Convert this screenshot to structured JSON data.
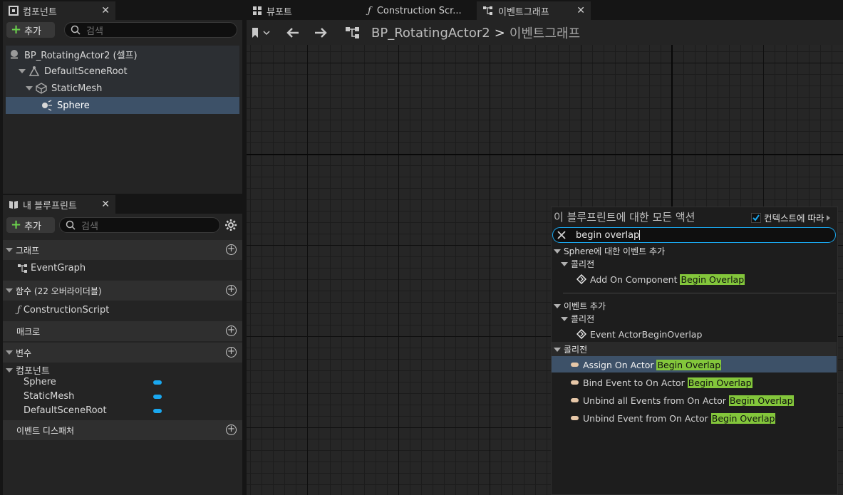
{
  "tabs": {
    "components": "컴포넌트",
    "viewport": "뷰포트",
    "construction": "Construction Scr...",
    "eventgraph": "이벤트그래프"
  },
  "components_panel": {
    "add_label": "추가",
    "search_placeholder": "검색",
    "tree": [
      {
        "label": "BP_RotatingActor2 (셀프)",
        "icon": "actor-icon"
      },
      {
        "label": "DefaultSceneRoot",
        "icon": "scene-root-icon"
      },
      {
        "label": "StaticMesh",
        "icon": "static-mesh-icon"
      },
      {
        "label": "Sphere",
        "icon": "sphere-light-icon"
      }
    ]
  },
  "blueprint_panel": {
    "title": "내 블루프린트",
    "add_label": "추가",
    "search_placeholder": "검색",
    "sections": {
      "graph": "그래프",
      "functions": "함수 (22 오버라이더블)",
      "macros": "매크로",
      "variables": "변수",
      "dispatchers": "이벤트 디스패처"
    },
    "graph_item": "EventGraph",
    "function_item": "ConstructionScript",
    "variables_group": "컴포넌트",
    "variables": [
      "Sphere",
      "StaticMesh",
      "DefaultSceneRoot"
    ],
    "variable_color": "#1aa8f0"
  },
  "breadcrumb": {
    "blueprint": "BP_RotatingActor2",
    "separator": ">",
    "graph": "이벤트그래프"
  },
  "action_menu": {
    "title": "이 블루프린트에 대한 모든 액션",
    "context_label": "컨텍스트에 따라",
    "context_checked": true,
    "search_value": "begin overlap",
    "group1": {
      "title": "Sphere에 대한 이벤트 추가",
      "sub": "콜리전",
      "item_prefix": "Add On Component ",
      "item_match": "Begin Overlap"
    },
    "group2": {
      "title": "이벤트 추가",
      "sub": "콜리전",
      "item": "Event ActorBeginOverlap"
    },
    "group3": {
      "title": "콜리전",
      "items": [
        {
          "prefix": "Assign On Actor ",
          "match": "Begin Overlap"
        },
        {
          "prefix": "Bind Event to On Actor ",
          "match": "Begin Overlap"
        },
        {
          "prefix": "Unbind all Events from On Actor ",
          "match": "Begin Overlap"
        },
        {
          "prefix": "Unbind Event from On Actor ",
          "match": "Begin Overlap"
        }
      ]
    },
    "highlight_color": "#83c63b"
  }
}
